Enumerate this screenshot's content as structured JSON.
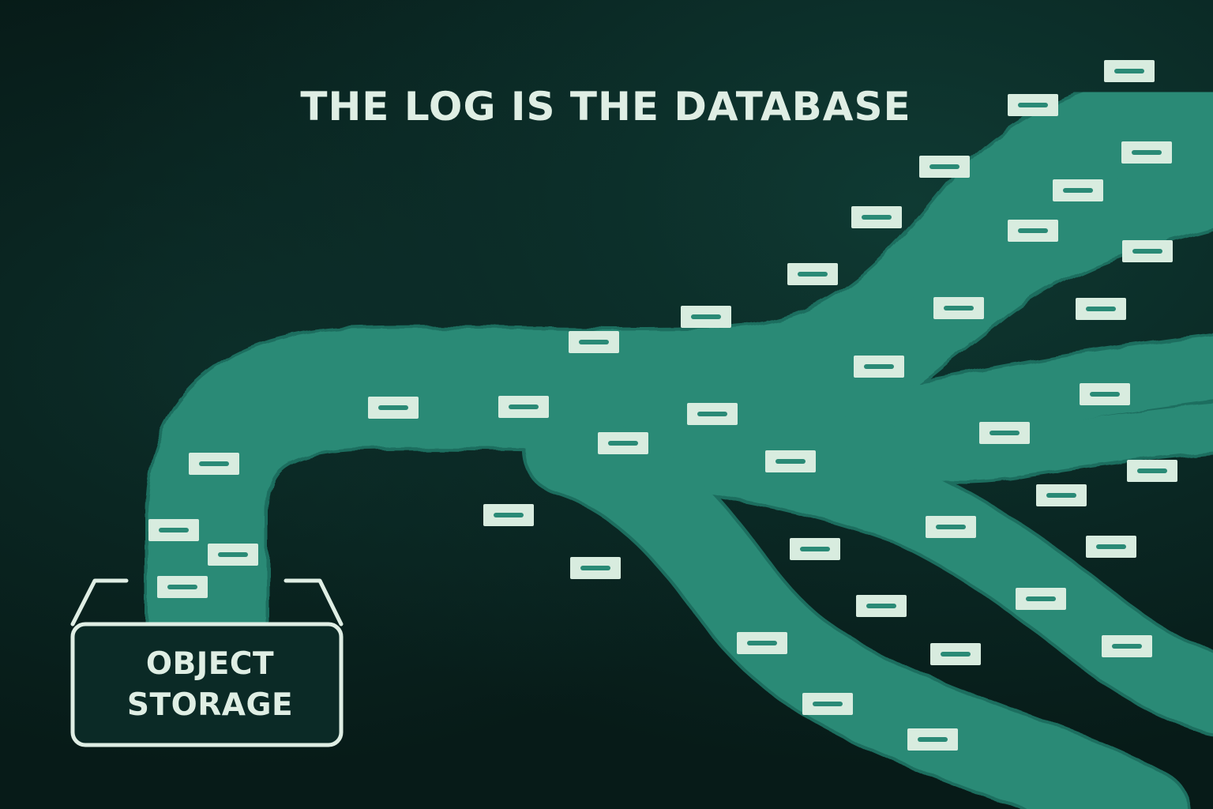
{
  "title": "THE LOG IS THE DATABASE",
  "storage": {
    "label_line1": "OBJECT",
    "label_line2": "STORAGE"
  },
  "colors": {
    "background": "#08201d",
    "stream": "#2a8a76",
    "stream_dark": "#1f6e5f",
    "record": "#d8ecdf",
    "record_mark": "#2a8a76",
    "text": "#dfeee4"
  },
  "icons": {
    "record": "log-record-icon",
    "bucket": "bucket-icon"
  }
}
